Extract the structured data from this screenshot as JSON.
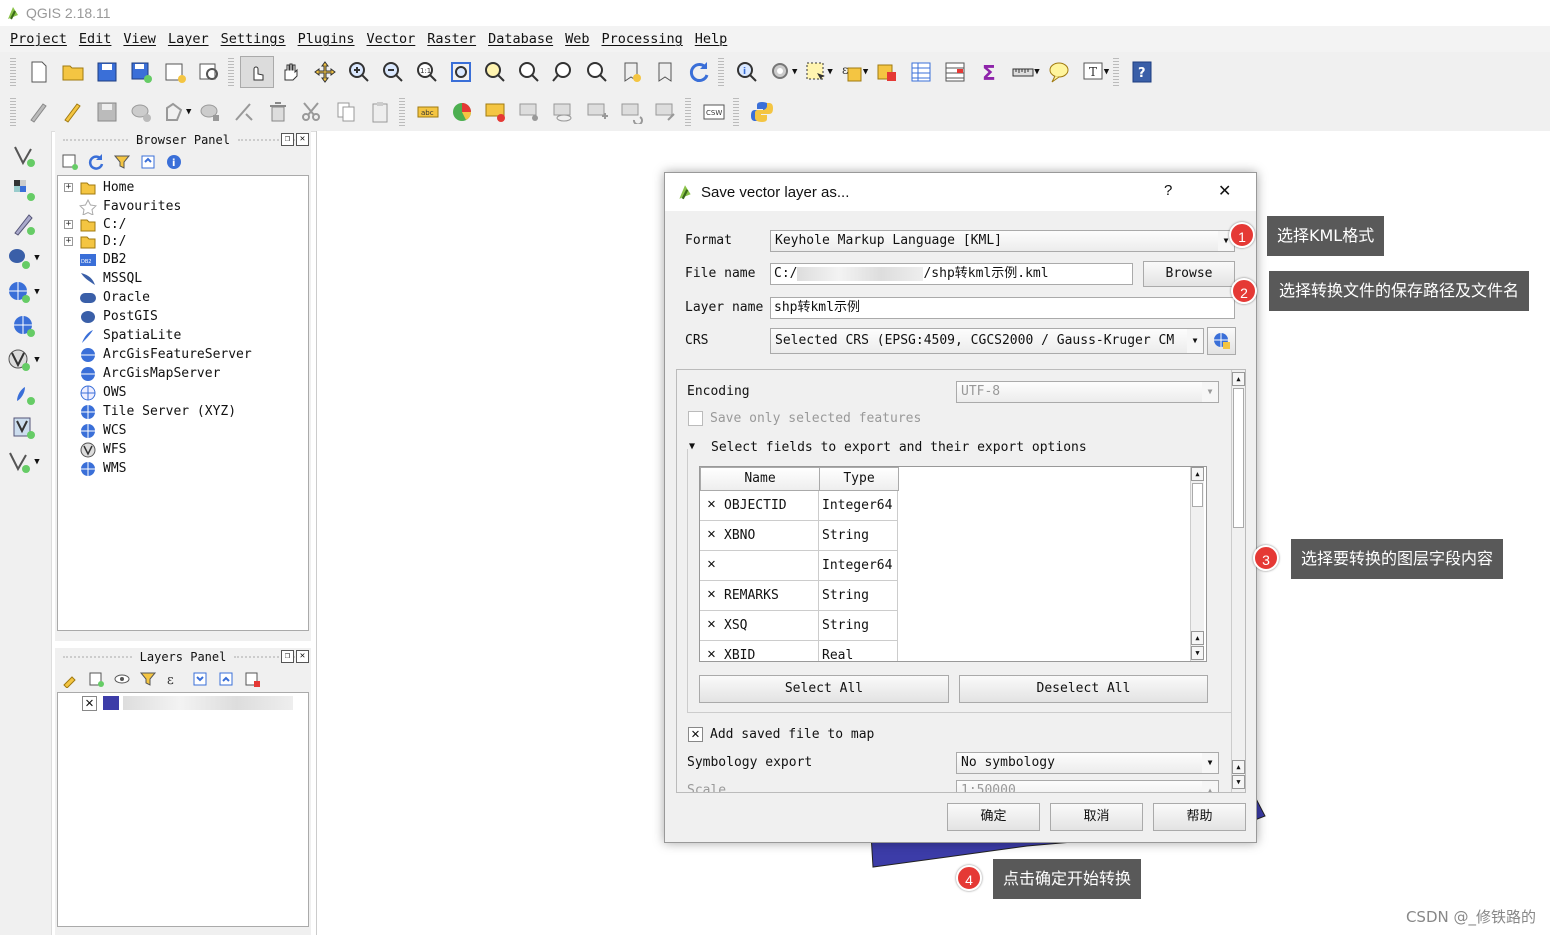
{
  "app": {
    "title": "QGIS 2.18.11"
  },
  "menu": [
    "Project",
    "Edit",
    "View",
    "Layer",
    "Settings",
    "Plugins",
    "Vector",
    "Raster",
    "Database",
    "Web",
    "Processing",
    "Help"
  ],
  "browser_panel": {
    "title": "Browser Panel",
    "items": [
      "Home",
      "Favourites",
      "C:/",
      "D:/",
      "DB2",
      "MSSQL",
      "Oracle",
      "PostGIS",
      "SpatiaLite",
      "ArcGisFeatureServer",
      "ArcGisMapServer",
      "OWS",
      "Tile Server (XYZ)",
      "WCS",
      "WFS",
      "WMS"
    ],
    "db2_badge": "DB2"
  },
  "layers_panel": {
    "title": "Layers Panel"
  },
  "toolbar2": {
    "csw_label": "CSW"
  },
  "dialog": {
    "title": "Save vector layer as...",
    "help_label": "?",
    "close_label": "✕",
    "format_label": "Format",
    "format_value": "Keyhole Markup Language [KML]",
    "filename_label": "File name",
    "filename_prefix": "C:/",
    "filename_suffix": "/shp转kml示例.kml",
    "browse_label": "Browse",
    "layername_label": "Layer name",
    "layername_value": "shp转kml示例",
    "crs_label": "CRS",
    "crs_value": "Selected CRS (EPSG:4509, CGCS2000 / Gauss-Kruger CM",
    "encoding_label": "Encoding",
    "encoding_value": "UTF-8",
    "save_selected_label": "Save only selected features",
    "fields_group_label": "Select fields to export and their export options",
    "fields_header": {
      "name": "Name",
      "type": "Type"
    },
    "fields": [
      {
        "name": "OBJECTID",
        "type": "Integer64",
        "checked": "✕"
      },
      {
        "name": "XBNO",
        "type": "String",
        "checked": "✕"
      },
      {
        "name": "",
        "type": "Integer64",
        "checked": "✕"
      },
      {
        "name": "REMARKS",
        "type": "String",
        "checked": "✕"
      },
      {
        "name": "XSQ",
        "type": "String",
        "checked": "✕"
      },
      {
        "name": "XBID",
        "type": "Real",
        "checked": "✕"
      }
    ],
    "select_all_label": "Select All",
    "deselect_all_label": "Deselect All",
    "add_to_map_label": "Add saved file to map",
    "add_to_map_check": "✕",
    "symbology_label": "Symbology export",
    "symbology_value": "No symbology",
    "scale_label": "Scale",
    "scale_value": "1:50000",
    "ok_label": "确定",
    "cancel_label": "取消",
    "help_button_label": "帮助"
  },
  "callouts": [
    {
      "num": "1",
      "text": "选择KML格式"
    },
    {
      "num": "2",
      "text": "选择转换文件的保存路径及文件名"
    },
    {
      "num": "3",
      "text": "选择要转换的图层字段内容"
    },
    {
      "num": "4",
      "text": "点击确定开始转换"
    }
  ],
  "layer_check": "✕",
  "watermark": "CSDN @_修铁路的",
  "colors": {
    "accent": "#3a6fd8",
    "polygon_fill": "#3c3ca8",
    "callout_bg": "#595959",
    "badge": "#e53935"
  }
}
